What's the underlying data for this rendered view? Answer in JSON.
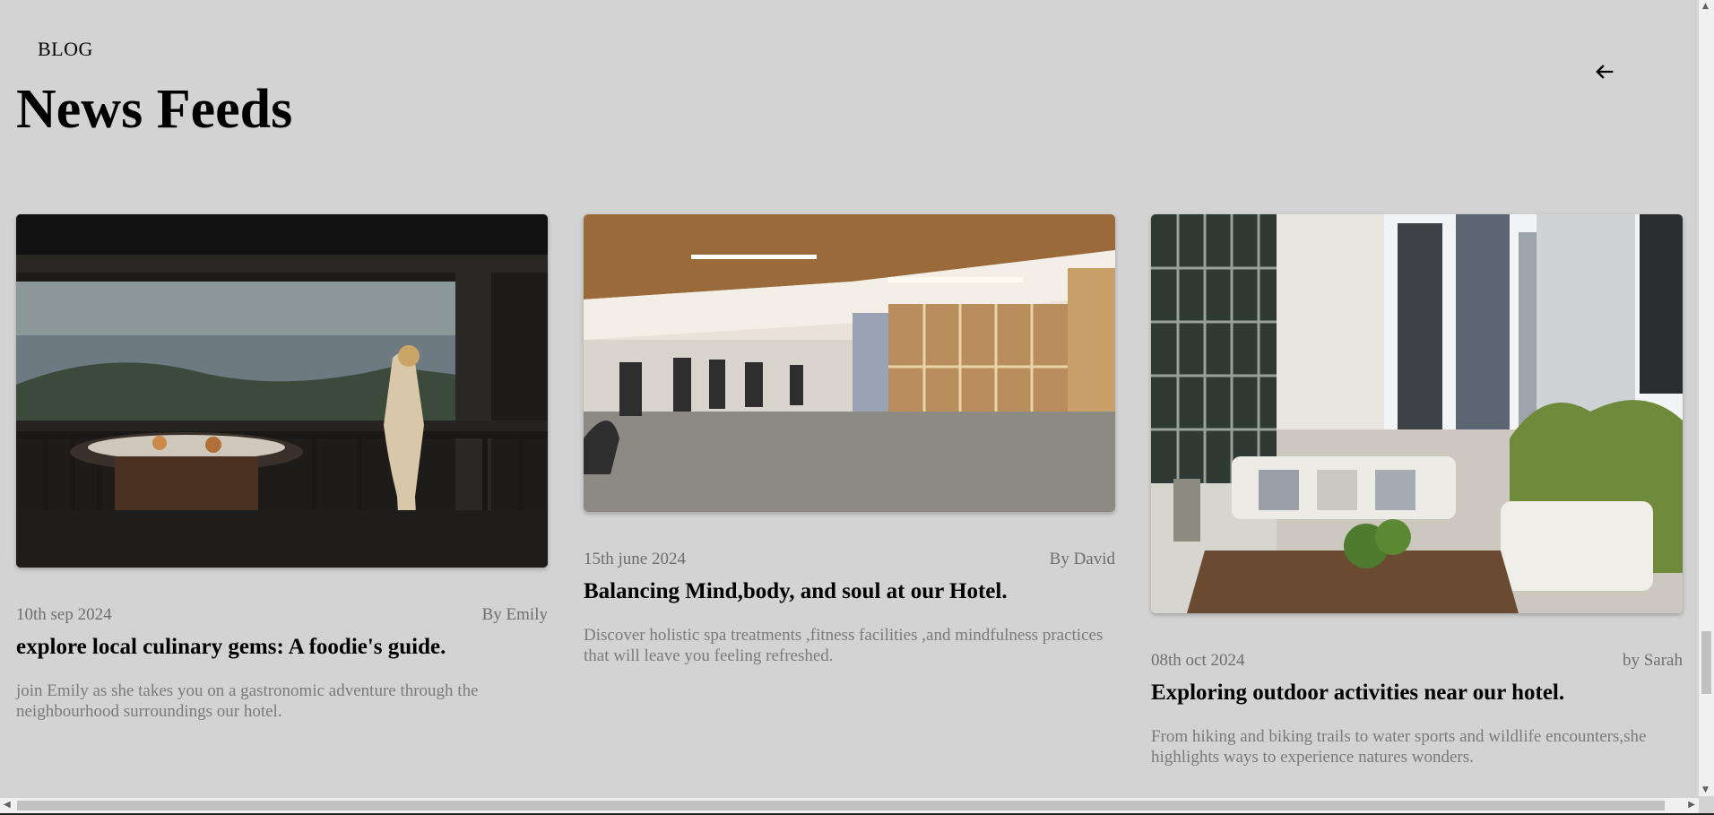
{
  "header": {
    "section_label": "BLOG",
    "page_title": "News Feeds"
  },
  "posts": [
    {
      "date": "10th sep 2024",
      "author": "By Emily",
      "title": "explore local culinary gems: A foodie's guide.",
      "description": "join Emily as she takes you on a gastronomic adventure through the neighbourhood surroundings our hotel.",
      "image": "balcony-breakfast-woman-photo"
    },
    {
      "date": "15th june 2024",
      "author": "By David",
      "title": "Balancing Mind,body, and soul at our Hotel.",
      "description": "Discover holistic spa treatments ,fitness facilities ,and mindfulness practices that will leave you feeling refreshed.",
      "image": "hotel-gym-photo"
    },
    {
      "date": "08th oct 2024",
      "author": "by Sarah",
      "title": "Exploring outdoor activities near our hotel.",
      "description": "From hiking and biking trails to water sports and wildlife encounters,she highlights ways to experience natures wonders.",
      "image": "rooftop-terrace-city-photo"
    }
  ],
  "colors": {
    "background": "#d3d3d3",
    "meta_text": "#6e6e6e",
    "description_text": "#7a7a7a"
  }
}
